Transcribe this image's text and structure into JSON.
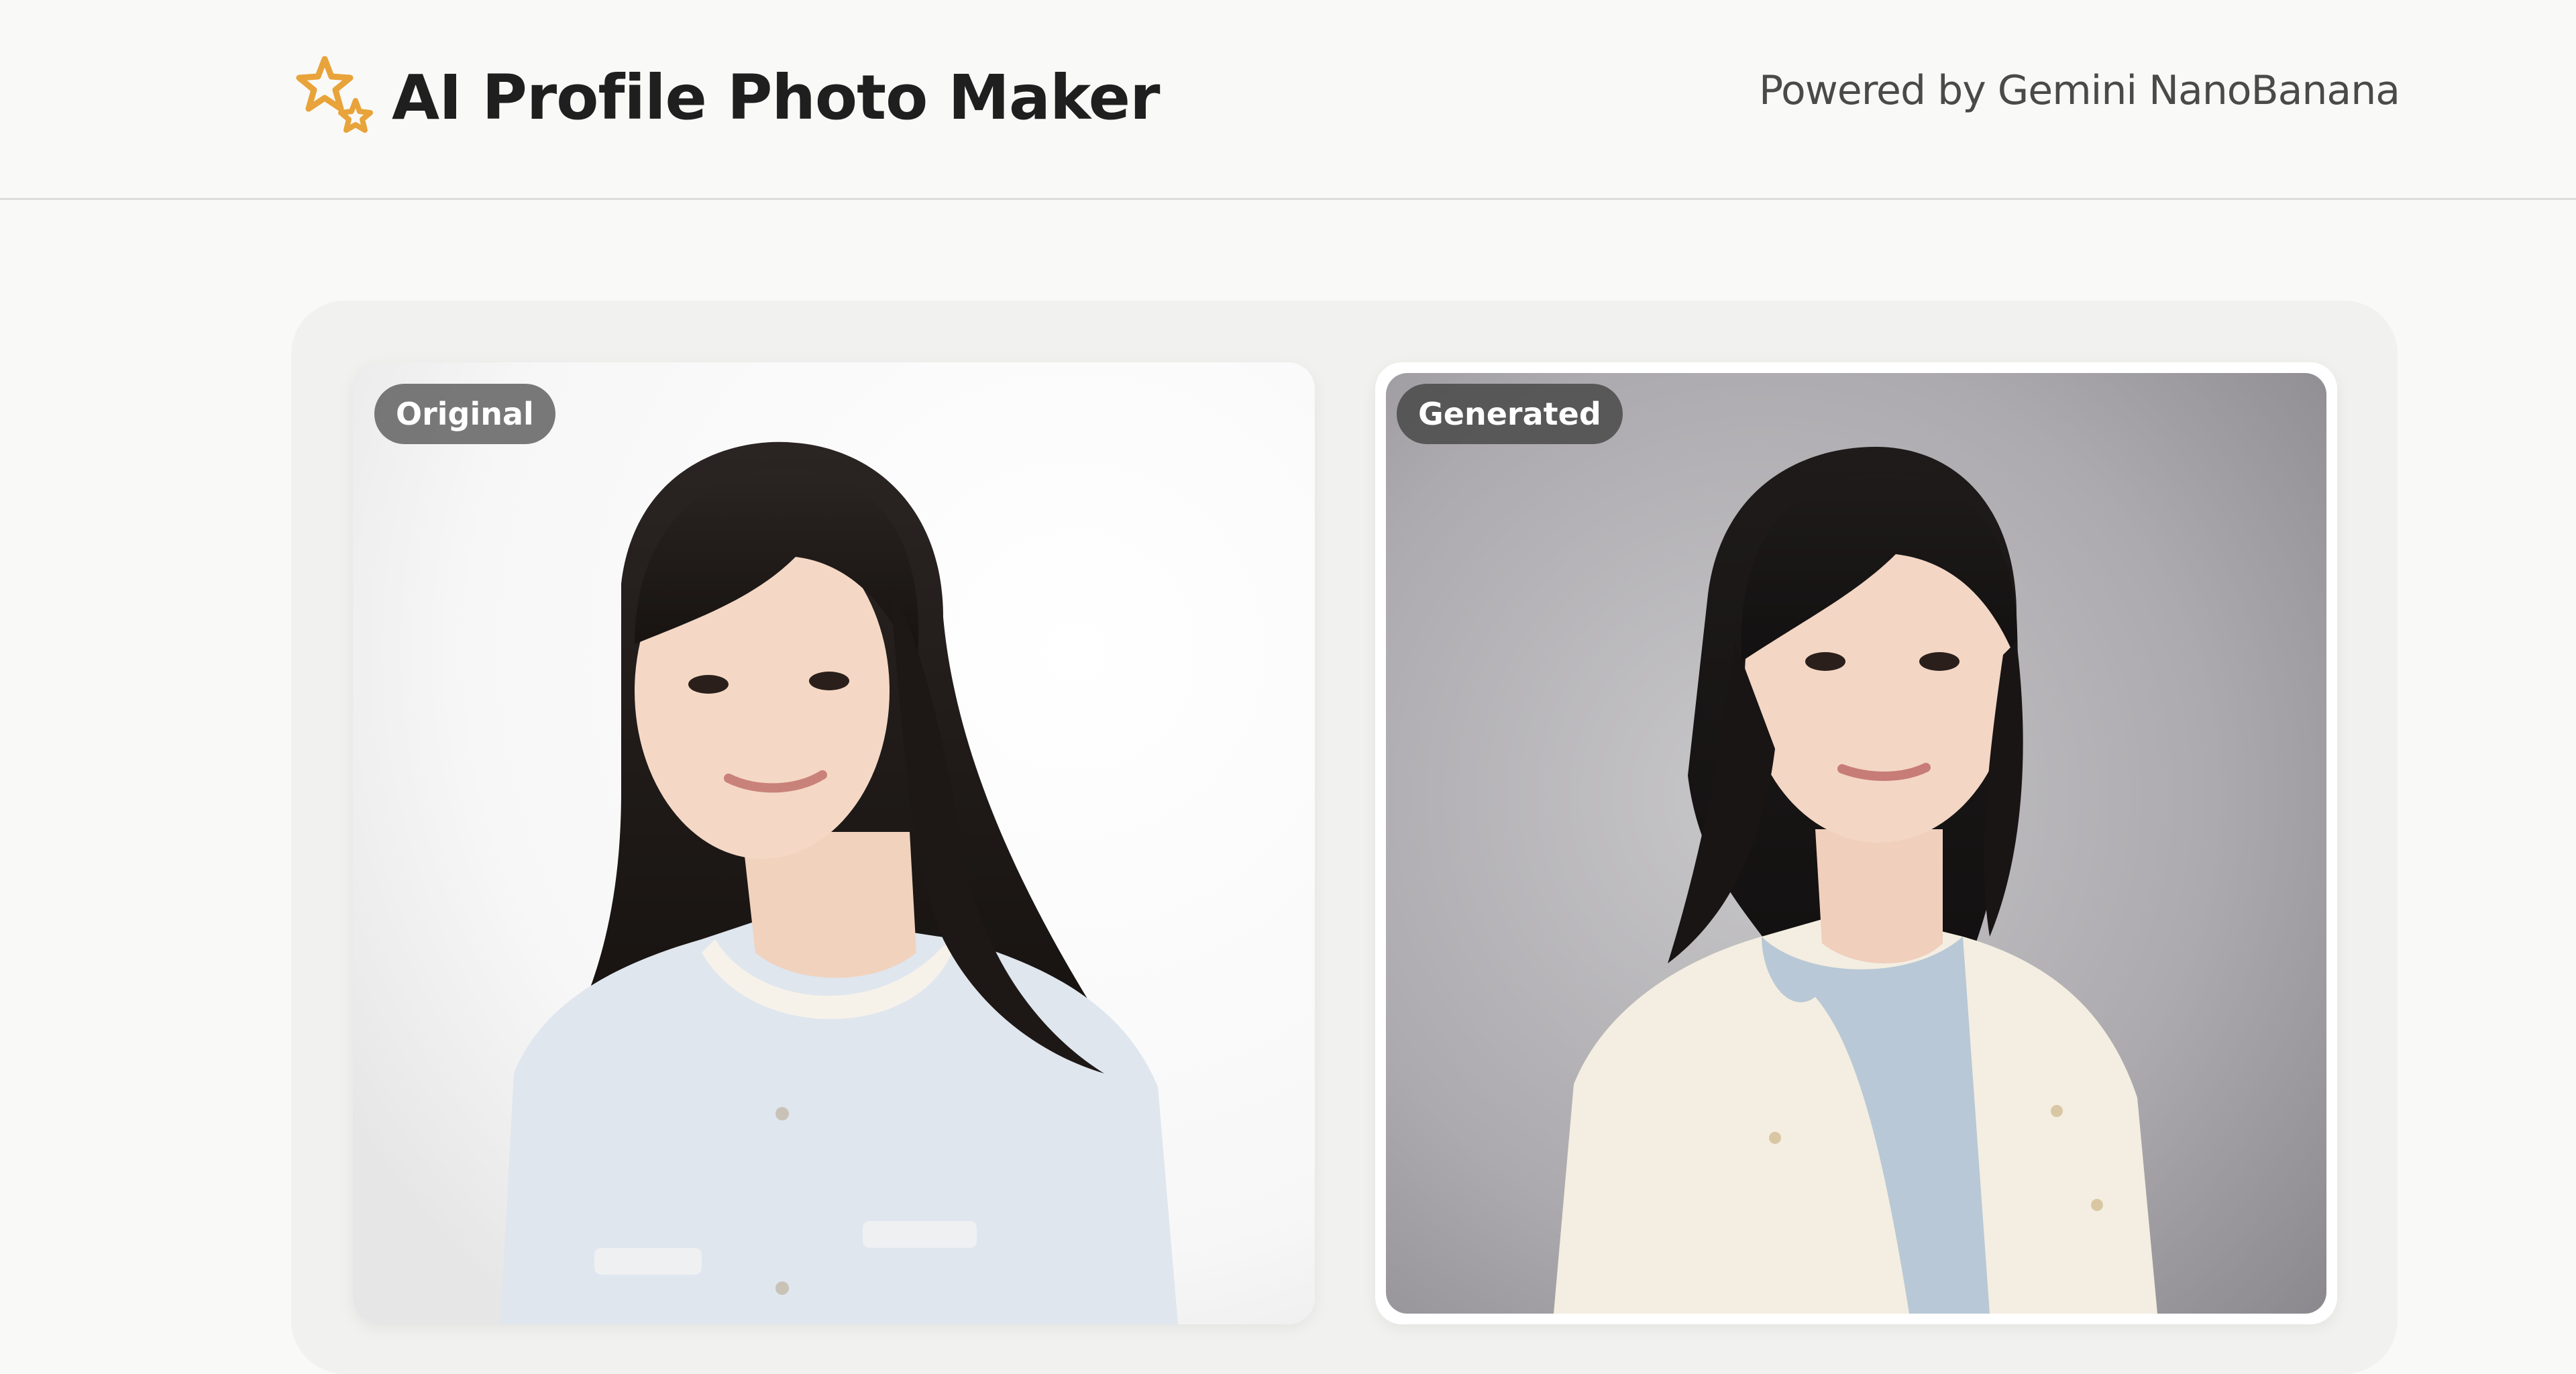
{
  "header": {
    "app_title": "AI Profile Photo Maker",
    "powered_by": "Powered by Gemini NanoBanana",
    "logo_icon": "sparkle-stars-icon",
    "logo_color": "#e8a33a"
  },
  "comparison": {
    "original": {
      "badge": "Original"
    },
    "generated": {
      "badge": "Generated"
    }
  }
}
